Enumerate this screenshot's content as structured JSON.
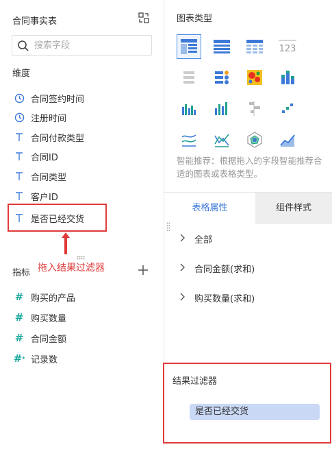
{
  "dataset": {
    "title": "合同事实表"
  },
  "search": {
    "placeholder": "搜索字段"
  },
  "dimensions": {
    "title": "维度",
    "fields": [
      {
        "label": "合同签约时间",
        "icon": "clock-icon"
      },
      {
        "label": "注册时间",
        "icon": "clock-icon"
      },
      {
        "label": "合同付款类型",
        "icon": "text-type-icon"
      },
      {
        "label": "合同ID",
        "icon": "text-type-icon"
      },
      {
        "label": "合同类型",
        "icon": "text-type-icon"
      },
      {
        "label": "客户ID",
        "icon": "text-type-icon"
      },
      {
        "label": "是否已经交货",
        "icon": "text-type-icon"
      }
    ]
  },
  "annotation": {
    "drag_hint": "拖入结果过滤器"
  },
  "metrics": {
    "title": "指标",
    "fields": [
      {
        "label": "购买的产品",
        "icon": "hash-icon"
      },
      {
        "label": "购买数量",
        "icon": "hash-icon"
      },
      {
        "label": "合同金额",
        "icon": "hash-icon"
      },
      {
        "label": "记录数",
        "icon": "hash-star-icon"
      }
    ]
  },
  "chart_types": {
    "title": "图表类型",
    "recommend": "智能推荐：根据拖入的字段智能推荐合适的图表或表格类型。",
    "items": [
      "grouped-table-icon",
      "detail-table-icon",
      "cross-table-icon",
      "kpi-number-icon",
      "list-icon",
      "dot-table-icon",
      "heatmap-icon",
      "stacked-bar-icon",
      "column-chart-icon",
      "bar-chart-icon",
      "horizontal-bar-icon",
      "scatter-icon",
      "line-chart-icon",
      "multi-line-icon",
      "radar-chart-icon",
      "area-chart-icon"
    ],
    "number_label": "123"
  },
  "tabs": {
    "active": "表格属性",
    "inactive": "组件样式"
  },
  "tree": [
    {
      "label": "全部"
    },
    {
      "label": "合同金额(求和)"
    },
    {
      "label": "购买数量(求和)"
    }
  ],
  "result_filter": {
    "title": "结果过滤器",
    "chip": "是否已经交货"
  },
  "colors": {
    "accent": "#3d7ad8",
    "highlight": "#e03a3a",
    "chip": "#c9d8f5"
  }
}
